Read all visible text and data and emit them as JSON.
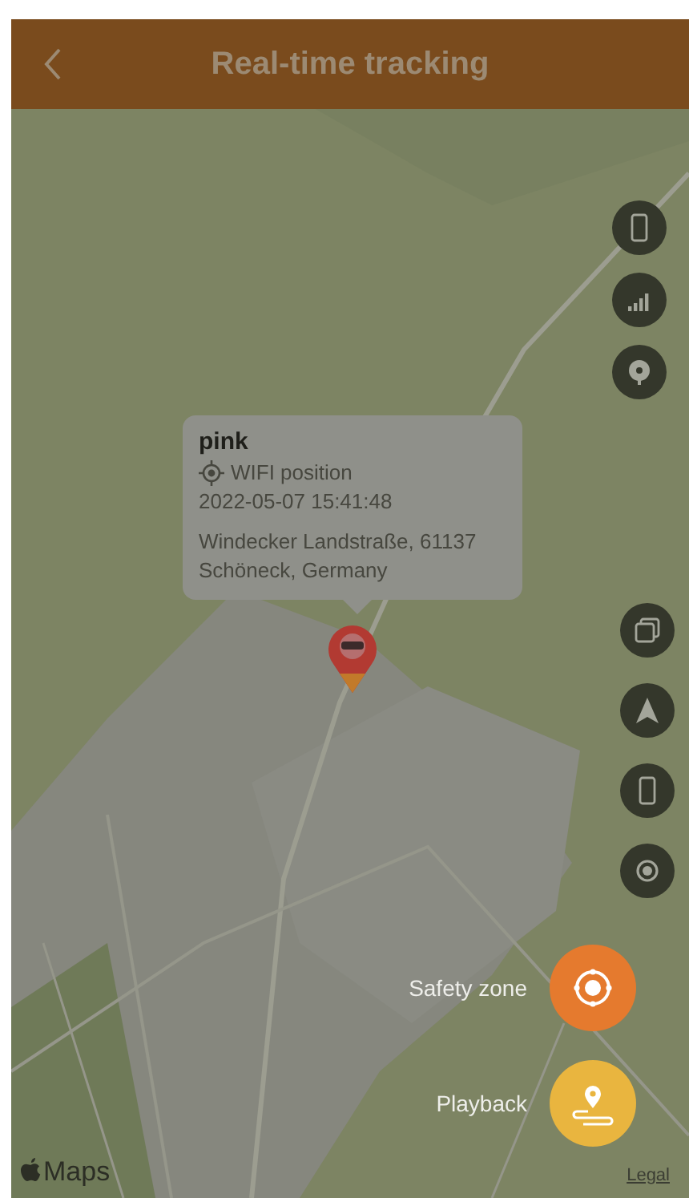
{
  "header": {
    "title": "Real-time tracking"
  },
  "popup": {
    "name": "pink",
    "position_type": "WIFI position",
    "time": "2022-05-07 15:41:48",
    "address_lines": [
      "Windecker Landstraße, 61137",
      "Schöneck, Germany"
    ]
  },
  "map_controls": [
    {
      "kind": "phone"
    },
    {
      "kind": "signal"
    },
    {
      "kind": "tower"
    }
  ],
  "view_controls": [
    {
      "kind": "layers"
    },
    {
      "kind": "navigate"
    },
    {
      "kind": "phone"
    },
    {
      "kind": "locate"
    }
  ],
  "actions": [
    {
      "kind": "safety",
      "label": "Safety zone",
      "color": "#e57a2e"
    },
    {
      "kind": "playback",
      "label": "Playback",
      "color": "#e9b53f"
    }
  ],
  "attribution": {
    "brand": "Maps",
    "legal": "Legal"
  }
}
